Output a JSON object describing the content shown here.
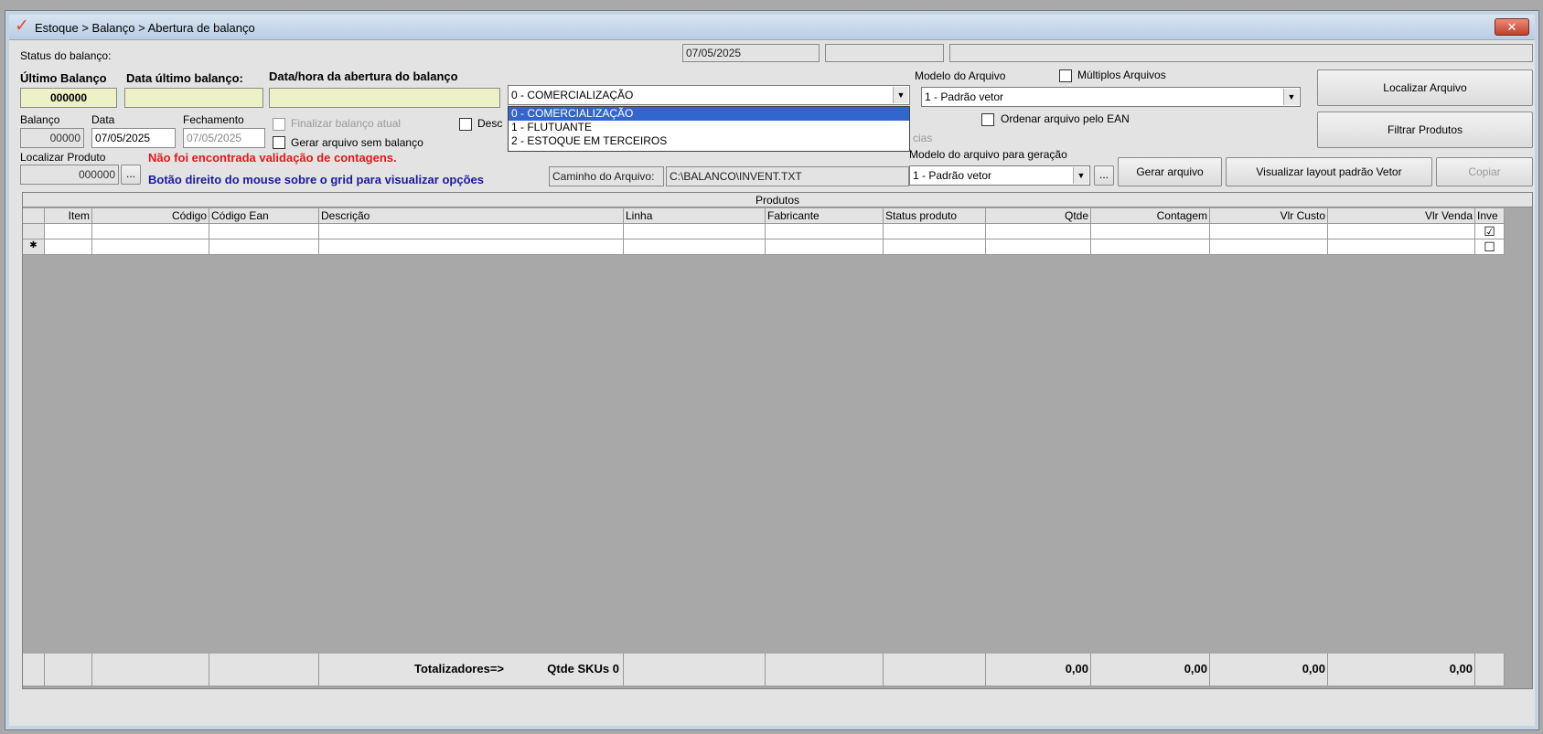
{
  "window": {
    "title": "Estoque > Balanço > Abertura de balanço",
    "close": "✕",
    "logo": "✓"
  },
  "status": {
    "label": "Status do balanço:",
    "date": "07/05/2025"
  },
  "ultimo": {
    "ultimo_label": "Último Balanço",
    "ultimo_value": "000000",
    "data_ultimo_label": "Data último balanço:",
    "data_ultimo_value": "",
    "abertura_label": "Data/hora da abertura do balanço",
    "abertura_value": ""
  },
  "tipo": {
    "selected": "0 - COMERCIALIZAÇÃO",
    "options": [
      "0 - COMERCIALIZAÇÃO",
      "1 - FLUTUANTE",
      "2 - ESTOQUE EM TERCEIROS"
    ]
  },
  "balanco": {
    "balanco_label": "Balanço",
    "balanco_value": "00000",
    "data_label": "Data",
    "data_value": "07/05/2025",
    "fechamento_label": "Fechamento",
    "fechamento_value": "07/05/2025"
  },
  "checks": {
    "finalizar": "Finalizar balanço atual",
    "gerar_sem": "Gerar arquivo sem balanço",
    "desc": "Desc",
    "multiplos": "Múltiplos Arquivos",
    "ordenar": "Ordenar arquivo pelo EAN",
    "cias": "cias"
  },
  "localizar": {
    "label": "Localizar Produto",
    "value": "000000",
    "browse": "...",
    "warning": "Não foi encontrada validação de contagens.",
    "hint": "Botão direito do mouse sobre o grid para visualizar opções",
    "warning_color": "#e0191b",
    "hint_color": "#1a1aa0"
  },
  "caminho": {
    "label": "Caminho do Arquivo:",
    "value": "C:\\BALANCO\\INVENT.TXT"
  },
  "modelo": {
    "label": "Modelo do Arquivo",
    "value": "1 - Padrão vetor",
    "geracao_label": "Modelo do arquivo para geração",
    "geracao_value": "1 - Padrão vetor",
    "browse": "..."
  },
  "buttons": {
    "localizar_arquivo": "Localizar Arquivo",
    "filtrar_produtos": "Filtrar Produtos",
    "gerar_arquivo": "Gerar arquivo",
    "visualizar_layout": "Visualizar layout padrão Vetor",
    "copiar": "Copiar"
  },
  "grid": {
    "caption": "Produtos",
    "columns": [
      "Item",
      "Código",
      "Código Ean",
      "Descrição",
      "Linha",
      "Fabricante",
      "Status produto",
      "Qtde",
      "Contagem",
      "Vlr Custo",
      "Vlr Venda",
      "Inve"
    ],
    "row_markers": [
      "",
      "✱"
    ],
    "checks": [
      "☑",
      "☐"
    ],
    "totals": {
      "label": "Totalizadores=>",
      "skus": "Qtde SKUs 0",
      "qtde": "0,00",
      "contagem": "0,00",
      "custo": "0,00",
      "venda": "0,00"
    }
  }
}
